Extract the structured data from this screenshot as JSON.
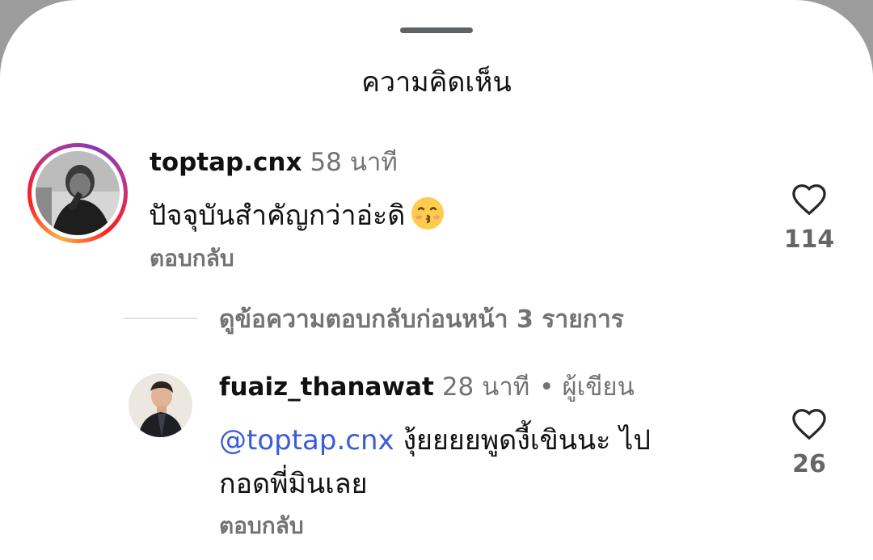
{
  "sheet": {
    "title": "ความคิดเห็น"
  },
  "comments": [
    {
      "username": "toptap.cnx",
      "time": "58 นาที",
      "text": "ปัจจุบันสำคัญกว่าอ่ะดิ",
      "emoji": "kissing-face-emoji",
      "reply_label": "ตอบกลับ",
      "like_count": "114"
    },
    {
      "username": "fuaiz_thanawat",
      "time": "28 นาที",
      "separator": "•",
      "author_tag": "ผู้เขียน",
      "mention": "@toptap.cnx",
      "text_line1": " งุ้ยยยยพูดงี้เขินนะ ไป",
      "text_line2": "กอดพี่มินเลย",
      "reply_label": "ตอบกลับ",
      "like_count": "26"
    }
  ],
  "view_previous_replies": "ดูข้อความตอบกลับก่อนหน้า 3 รายการ",
  "icons": {
    "like": "heart-outline-icon"
  }
}
